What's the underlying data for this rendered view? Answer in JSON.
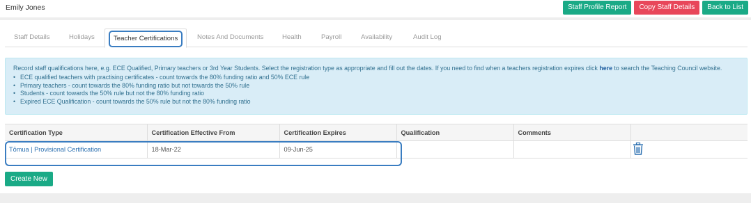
{
  "header": {
    "staff_name": "Emily Jones",
    "buttons": {
      "profile_report": "Staff Profile Report",
      "copy_details": "Copy Staff Details",
      "back": "Back to List"
    },
    "colors": {
      "primary": "#1aaa86",
      "danger": "#e8475a"
    }
  },
  "tabs": [
    {
      "label": "Staff Details"
    },
    {
      "label": "Holidays"
    },
    {
      "label": "Teacher Certifications",
      "active": true
    },
    {
      "label": "Notes And Documents"
    },
    {
      "label": "Health"
    },
    {
      "label": "Payroll"
    },
    {
      "label": "Availability"
    },
    {
      "label": "Audit Log"
    }
  ],
  "info": {
    "intro_before": "Record staff qualifications here, e.g. ECE Qualified, Primary teachers or 3rd Year Students. Select the registration type as appropriate and fill out the dates. If you need to find when a teachers registration expires click ",
    "link": "here",
    "intro_after": " to search the Teaching Council website.",
    "bullets": [
      "ECE qualified teachers with practising certificates - count towards the 80% funding ratio and 50% ECE rule",
      "Primary teachers - count towards the 80% funding ratio but not towards the 50% rule",
      "Students - count towards the 50% rule but not the 80% funding ratio",
      "Expired ECE Qualification - count towards the 50% rule but not the 80% funding ratio"
    ]
  },
  "table": {
    "columns": [
      "Certification Type",
      "Certification Effective From",
      "Certification Expires",
      "Qualification",
      "Comments",
      ""
    ],
    "rows": [
      {
        "type": "Tōmua | Provisional Certification",
        "effective_from": "18-Mar-22",
        "expires": "09-Jun-25",
        "qualification": "",
        "comments": "",
        "action_icon": "trash-icon"
      }
    ]
  },
  "create_button": "Create New"
}
